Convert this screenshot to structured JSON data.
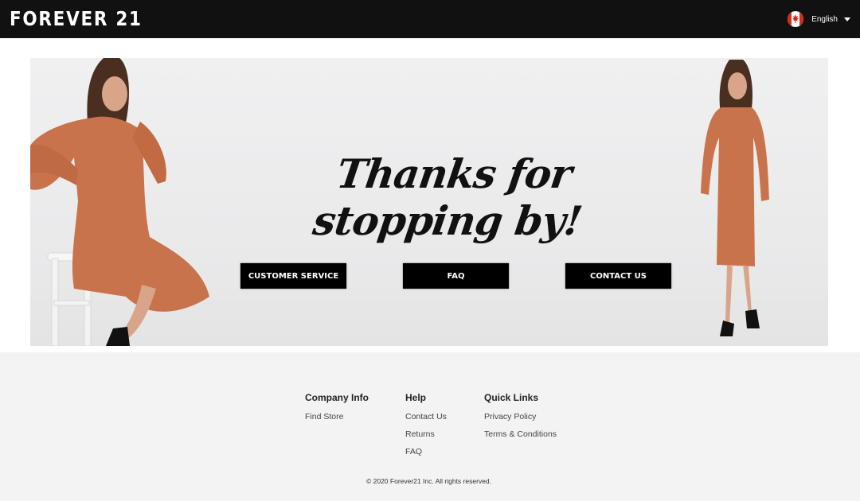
{
  "header": {
    "logo_text": "FOREVER 21",
    "language": {
      "label": "English",
      "flag_icon": "canada-flag-icon",
      "dropdown_icon": "caret-down-icon"
    }
  },
  "hero": {
    "headline": "Thanks for stopping by!",
    "buttons": [
      {
        "label": "CUSTOMER SERVICE"
      },
      {
        "label": "FAQ"
      },
      {
        "label": "CONTACT US"
      }
    ],
    "colors": {
      "dress": "#c9734d",
      "background": "#ececed"
    }
  },
  "footer": {
    "columns": [
      {
        "title": "Company Info",
        "links": [
          "Find Store"
        ]
      },
      {
        "title": "Help",
        "links": [
          "Contact Us",
          "Returns",
          "FAQ"
        ]
      },
      {
        "title": "Quick Links",
        "links": [
          "Privacy Policy",
          "Terms & Conditions"
        ]
      }
    ],
    "copyright": "© 2020 Forever21 Inc. All rights reserved."
  },
  "colors": {
    "header_bg": "#111111",
    "footer_bg": "#f3f3f3",
    "button_bg": "#000000",
    "flag_red": "#d52b1e"
  }
}
